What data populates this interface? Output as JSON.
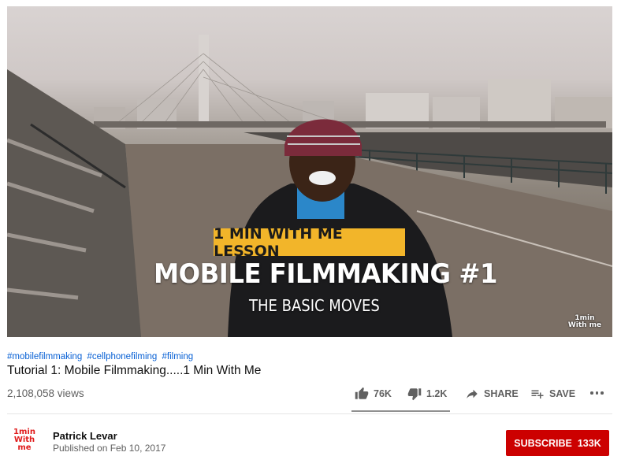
{
  "video": {
    "overlay_tag": "1 MIN WITH ME LESSON",
    "overlay_headline": "MOBILE FILMMAKING #1",
    "overlay_subline": "THE BASIC MOVES",
    "watermark_line1": "1min",
    "watermark_line2": "With me"
  },
  "hashtags": [
    "#mobilefilmmaking",
    "#cellphonefilming",
    "#filming"
  ],
  "title": "Tutorial 1: Mobile Filmmaking.....1 Min With Me",
  "views": "2,108,058 views",
  "actions": {
    "likes": "76K",
    "dislikes": "1.2K",
    "share_label": "SHARE",
    "save_label": "SAVE",
    "like_icon": "thumbs-up-icon",
    "dislike_icon": "thumbs-down-icon",
    "share_icon": "share-arrow-icon",
    "save_icon": "playlist-add-icon",
    "more_icon": "more-horizontal-icon"
  },
  "channel": {
    "name": "Patrick Levar",
    "published": "Published on Feb 10, 2017",
    "avatar_line1": "1min",
    "avatar_line2": "With me"
  },
  "subscribe": {
    "label": "SUBSCRIBE",
    "count": "133K",
    "color": "#cc0000"
  },
  "colors": {
    "link": "#065fd4",
    "secondary_text": "#606060",
    "accent_yellow": "#f2b52a"
  }
}
